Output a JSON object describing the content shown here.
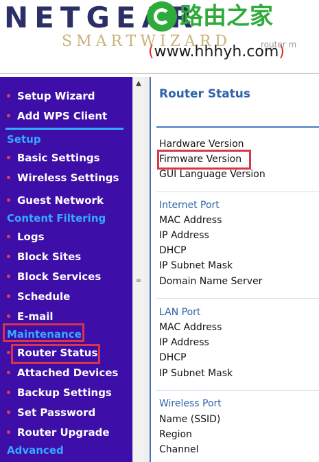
{
  "header": {
    "brand": "NETGEAR",
    "subtitle": "SMARTWIZARD",
    "subtitle_tail": "router m"
  },
  "watermark": {
    "name": "路由之家",
    "url": "www.hhhyh.com",
    "paren_open": "(",
    "paren_close": ")",
    "logo_icon": "luyou-logo-icon",
    "color_green": "#2fab3b",
    "color_red": "#e2241b"
  },
  "sidebar": {
    "top_items": [
      {
        "label": "Setup Wizard"
      },
      {
        "label": "Add WPS Client"
      }
    ],
    "setup_heading": "Setup",
    "setup_items": [
      {
        "label": "Basic Settings"
      },
      {
        "label": "Wireless Settings"
      },
      {
        "label": "Guest Network"
      }
    ],
    "content_heading": "Content Filtering",
    "content_items": [
      {
        "label": "Logs"
      },
      {
        "label": "Block Sites"
      },
      {
        "label": "Block Services"
      },
      {
        "label": "Schedule"
      },
      {
        "label": "E-mail"
      }
    ],
    "maintenance_heading": "Maintenance",
    "maintenance_items": [
      {
        "label": "Router Status"
      },
      {
        "label": "Attached Devices"
      },
      {
        "label": "Backup Settings"
      },
      {
        "label": "Set Password"
      },
      {
        "label": "Router Upgrade"
      }
    ],
    "advanced_heading": "Advanced"
  },
  "scrollbar": {
    "up_icon": "▲",
    "grip_icon": "≡"
  },
  "main": {
    "title": "Router Status",
    "general_fields": [
      {
        "label": "Hardware Version"
      },
      {
        "label": "Firmware Version"
      },
      {
        "label": "GUI Language Version"
      }
    ],
    "internet_port": {
      "title": "Internet Port",
      "fields": [
        {
          "label": "MAC Address"
        },
        {
          "label": "IP Address"
        },
        {
          "label": "DHCP"
        },
        {
          "label": "IP Subnet Mask"
        },
        {
          "label": "Domain Name Server"
        }
      ]
    },
    "lan_port": {
      "title": "LAN Port",
      "fields": [
        {
          "label": "MAC Address"
        },
        {
          "label": "IP Address"
        },
        {
          "label": "DHCP"
        },
        {
          "label": "IP Subnet Mask"
        }
      ]
    },
    "wireless_port": {
      "title": "Wireless Port",
      "fields": [
        {
          "label": "Name (SSID)"
        },
        {
          "label": "Region"
        },
        {
          "label": "Channel"
        }
      ]
    }
  },
  "colors": {
    "sidebar_bg": "#3d0ea8",
    "sidebar_heading": "#37a9ff",
    "bullet": "#e23c58",
    "highlight_box": "#d93447",
    "main_title": "#2f64a8"
  }
}
